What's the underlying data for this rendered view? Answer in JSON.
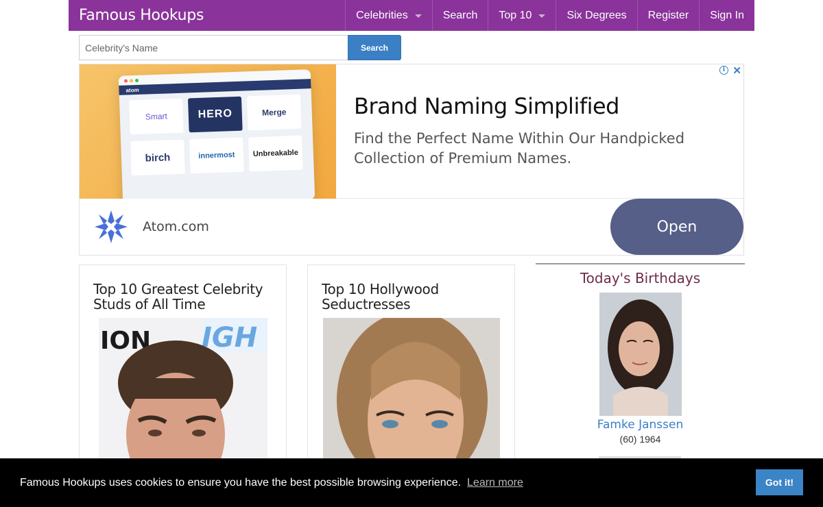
{
  "navbar": {
    "brand": "Famous Hookups",
    "items": [
      {
        "label": "Celebrities",
        "dropdown": true
      },
      {
        "label": "Search",
        "dropdown": false
      },
      {
        "label": "Top 10",
        "dropdown": true
      },
      {
        "label": "Six Degrees",
        "dropdown": false
      },
      {
        "label": "Register",
        "dropdown": false
      },
      {
        "label": "Sign In",
        "dropdown": false
      }
    ]
  },
  "search": {
    "placeholder": "Celebrity's Name",
    "button_label": "Search"
  },
  "ad": {
    "headline": "Brand Naming Simplified",
    "body": "Find the Perfect Name Within Our Handpicked Collection of Premium Names.",
    "domain": "Atom.com",
    "cta_label": "Open",
    "mock_logo": "atom",
    "tiles": [
      "Smart",
      "HERO",
      "Merge",
      "birch",
      "innermost",
      "Unbreakable"
    ],
    "info_icon": "info-icon",
    "close_icon": "close-icon"
  },
  "cards": [
    {
      "title": "Top 10 Greatest Celebrity Studs of All Time"
    },
    {
      "title": "Top 10 Hollywood Seductresses"
    }
  ],
  "sidebar": {
    "title": "Today's Birthdays",
    "birthdays": [
      {
        "name": "Famke Janssen",
        "age_year": "(60) 1964"
      }
    ]
  },
  "cookie": {
    "message": "Famous Hookups uses cookies to ensure you have the best possible browsing experience.",
    "learn_more": "Learn more",
    "accept": "Got it!"
  },
  "colors": {
    "navbar": "#8a339a",
    "accent_blue": "#3b7fc4",
    "ad_button": "#555f87",
    "sidebar_title": "#6e2c4a"
  }
}
